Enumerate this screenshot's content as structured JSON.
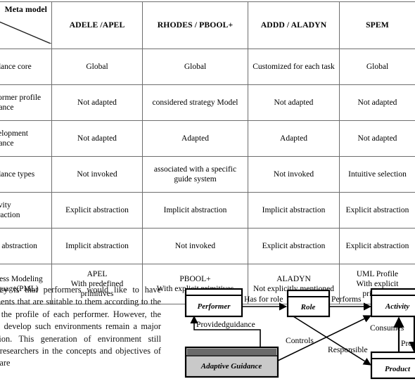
{
  "table": {
    "corner_label": "Meta model",
    "columns": [
      "ADELE /APEL",
      "RHODES / PBOOL+",
      "ADDD / ALADYN",
      "SPEM"
    ],
    "rows": [
      {
        "criterion": "Guidance core",
        "cells": [
          "Global",
          "Global",
          "Customized for each task",
          "Global"
        ]
      },
      {
        "criterion": "Performer profile guidance",
        "cells": [
          "Not adapted",
          "considered   strategy Model",
          "Not adapted",
          "Not adapted"
        ]
      },
      {
        "criterion": "Development guidance",
        "cells": [
          "Not adapted",
          "Adapted",
          "Adapted",
          "Not adapted"
        ]
      },
      {
        "criterion": "Guidance types",
        "cells": [
          "Not invoked",
          "associated with a specific guide system",
          "Not invoked",
          "Intuitive selection"
        ]
      },
      {
        "criterion": "Activity abstraction",
        "cells": [
          "Explicit abstraction",
          "Implicit   abstraction",
          "Implicit abstraction",
          "Explicit abstraction"
        ]
      },
      {
        "criterion": "Task abstraction",
        "cells": [
          "Implicit abstraction",
          "Not invoked",
          "Explicit abstraction",
          "Explicit abstraction"
        ]
      },
      {
        "criterion": "Process Modeling Language(PML)",
        "cells": [
          "APEL\nWith predefined primitives",
          "PBOOL+\nWith explicit  primitives",
          "ALADYN\nNot explicitly mentioned",
          "UML Profile\nWith explicit primitive"
        ]
      }
    ]
  },
  "body_text": {
    "paragraph": "consistency is that performers would like to have environments that are suitable to them according to the role and the profile of each performer. However, the means to develop such environments remain a major contribution. This generation of environment still interests researchers in the concepts and objectives of the software"
  },
  "diagram": {
    "nodes": [
      {
        "id": "performer",
        "label": "Performer",
        "style": "white"
      },
      {
        "id": "role",
        "label": "Role",
        "style": "white"
      },
      {
        "id": "activity",
        "label": "Activity",
        "style": "white"
      },
      {
        "id": "product",
        "label": "Product",
        "style": "white"
      },
      {
        "id": "adaptive_guidance",
        "label": "Adaptive Guidance",
        "style": "gray"
      }
    ],
    "edges": [
      {
        "from": "performer",
        "to": "role",
        "label": "Has for role"
      },
      {
        "from": "role",
        "to": "activity",
        "label": "Performs"
      },
      {
        "from": "adaptive_guidance",
        "to": "performer",
        "label": "Providedguidance"
      },
      {
        "from": "adaptive_guidance",
        "to": "activity",
        "label": "Controls"
      },
      {
        "from": "role",
        "to": "product",
        "label": "Responsible"
      },
      {
        "from": "product",
        "to": "activity",
        "label": "Consumes"
      },
      {
        "from": "activity",
        "to": "product",
        "label": "Produces"
      }
    ],
    "colors": {
      "gray_header": "#6a6a6a",
      "gray_body": "#c9c9c9",
      "stroke": "#000000"
    }
  }
}
